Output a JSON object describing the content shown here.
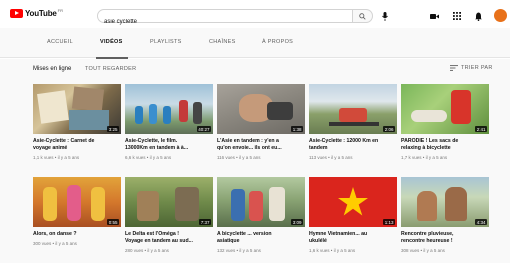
{
  "header": {
    "logo_text": "YouTube",
    "logo_country": "FR",
    "search_value": "asie cyclette"
  },
  "tabs": [
    {
      "label": "ACCUEIL"
    },
    {
      "label": "VIDÉOS"
    },
    {
      "label": "PLAYLISTS"
    },
    {
      "label": "CHAÎNES"
    },
    {
      "label": "À PROPOS"
    }
  ],
  "section": {
    "title": "Mises en ligne",
    "view_all": "TOUT REGARDER",
    "sort": "TRIER PAR"
  },
  "videos": [
    {
      "title_1": "Asie-Cyclette : Carnet de",
      "title_2": "voyage animé",
      "meta": "1,1 k vues • il y a 5 ans",
      "duration": "3:25"
    },
    {
      "title_1": "Asie-Cyclette, le film.",
      "title_2": "13000Km en tandem à à...",
      "meta": "6,6 k vues • il y a 5 ans",
      "duration": "40:27"
    },
    {
      "title_1": "L'Asie en tandem : y'en a",
      "title_2": "qu'on envoie... ils ont eu...",
      "meta": "116 vues • il y a 5 ans",
      "duration": "1:38"
    },
    {
      "title_1": "Asie-Cyclette : 12000 Km en",
      "title_2": "tandem",
      "meta": "113 vues • il y a 5 ans",
      "duration": "2:06"
    },
    {
      "title_1": "PARODIE ! Les sacs de",
      "title_2": "relaxing à bicyclette",
      "meta": "1,7 k vues • il y a 5 ans",
      "duration": "2:41"
    },
    {
      "title_1": "Alors, on danse ?",
      "title_2": "",
      "meta": "300 vues • il y a 5 ans",
      "duration": "0:55"
    },
    {
      "title_1": "Le Delta est l'Oméga !",
      "title_2": "Voyage en tandem au sud...",
      "meta": "280 vues • il y a 5 ans",
      "duration": "7:37"
    },
    {
      "title_1": "A bicyclette ... version",
      "title_2": "asiatique",
      "meta": "132 vues • il y a 5 ans",
      "duration": "3:09"
    },
    {
      "title_1": "Hymne Vietnamien... au",
      "title_2": "ukulélé",
      "meta": "1,6 k vues • il y a 5 ans",
      "duration": "1:13"
    },
    {
      "title_1": "Rencontre pluvieuse,",
      "title_2": "rencontre heureuse !",
      "meta": "308 vues • il y a 5 ans",
      "duration": "4:34"
    }
  ],
  "colors": {
    "brand_red": "#ff0000",
    "avatar": "#e8711a",
    "page_bg": "#f9f9f9"
  },
  "icons": [
    "youtube-logo-icon",
    "search-icon",
    "mic-icon",
    "create-video-icon",
    "apps-grid-icon",
    "notifications-bell-icon",
    "sort-icon"
  ]
}
